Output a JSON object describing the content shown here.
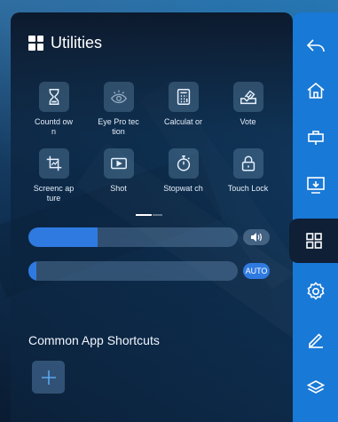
{
  "panel": {
    "title": "Utilities",
    "tools": [
      {
        "label": "Countd own",
        "icon": "hourglass-icon",
        "name": "tool-countdown"
      },
      {
        "label": "Eye Pro tection",
        "icon": "eye-protection-icon",
        "name": "tool-eye-protection"
      },
      {
        "label": "Calculat or",
        "icon": "calculator-icon",
        "name": "tool-calculator"
      },
      {
        "label": "Vote",
        "icon": "vote-icon",
        "name": "tool-vote"
      },
      {
        "label": "Screenc apture",
        "icon": "screen-capture-icon",
        "name": "tool-screencapture"
      },
      {
        "label": "Shot",
        "icon": "camera-shot-icon",
        "name": "tool-shot"
      },
      {
        "label": "Stopwat ch",
        "icon": "stopwatch-icon",
        "name": "tool-stopwatch"
      },
      {
        "label": "Touch Lock",
        "icon": "lock-icon",
        "name": "tool-touch-lock"
      }
    ],
    "volume_level": 0.33,
    "brightness_level": 0.04,
    "auto_label": "AUTO",
    "shortcuts_title": "Common App Shortcuts"
  },
  "sidebar": {
    "items": [
      {
        "icon": "back-icon",
        "name": "sidebar-back"
      },
      {
        "icon": "home-icon",
        "name": "sidebar-home"
      },
      {
        "icon": "signal-source-icon",
        "name": "sidebar-signal-source"
      },
      {
        "icon": "screen-share-icon",
        "name": "sidebar-screen-share"
      },
      {
        "icon": "apps-icon",
        "name": "sidebar-utilities",
        "active": true
      },
      {
        "icon": "settings-icon",
        "name": "sidebar-settings"
      },
      {
        "icon": "pen-icon",
        "name": "sidebar-annotation"
      },
      {
        "icon": "layers-icon",
        "name": "sidebar-layers"
      }
    ]
  },
  "colors": {
    "accent": "#2f7ae0",
    "sidebar": "#1979d6",
    "panel": "#0b1628"
  }
}
